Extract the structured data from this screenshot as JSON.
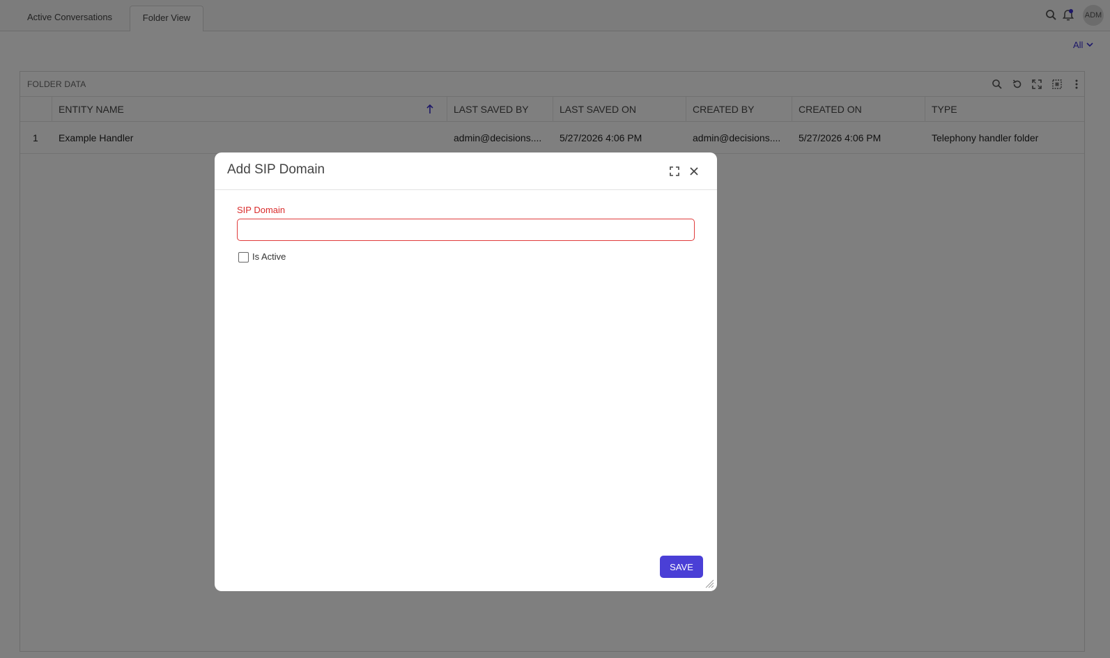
{
  "tabs": [
    {
      "label": "Active Conversations"
    },
    {
      "label": "Folder View"
    }
  ],
  "header": {
    "avatar_text": "ADM",
    "accent_color": "#3b2fd1"
  },
  "filter": {
    "label": "All"
  },
  "panel": {
    "title": "FOLDER DATA",
    "columns": [
      "ENTITY NAME",
      "LAST SAVED BY",
      "LAST SAVED ON",
      "CREATED BY",
      "CREATED ON",
      "TYPE"
    ],
    "rows": [
      {
        "index": "1",
        "entity_name": "Example Handler",
        "last_saved_by": "admin@decisions....",
        "last_saved_on": "5/27/2026 4:06 PM",
        "created_by": "admin@decisions....",
        "created_on": "5/27/2026 4:06 PM",
        "type": "Telephony handler folder"
      }
    ]
  },
  "modal": {
    "title": "Add SIP Domain",
    "field_label": "SIP Domain",
    "field_value": "",
    "checkbox_label": "Is Active",
    "checkbox_checked": false,
    "save_label": "SAVE"
  }
}
